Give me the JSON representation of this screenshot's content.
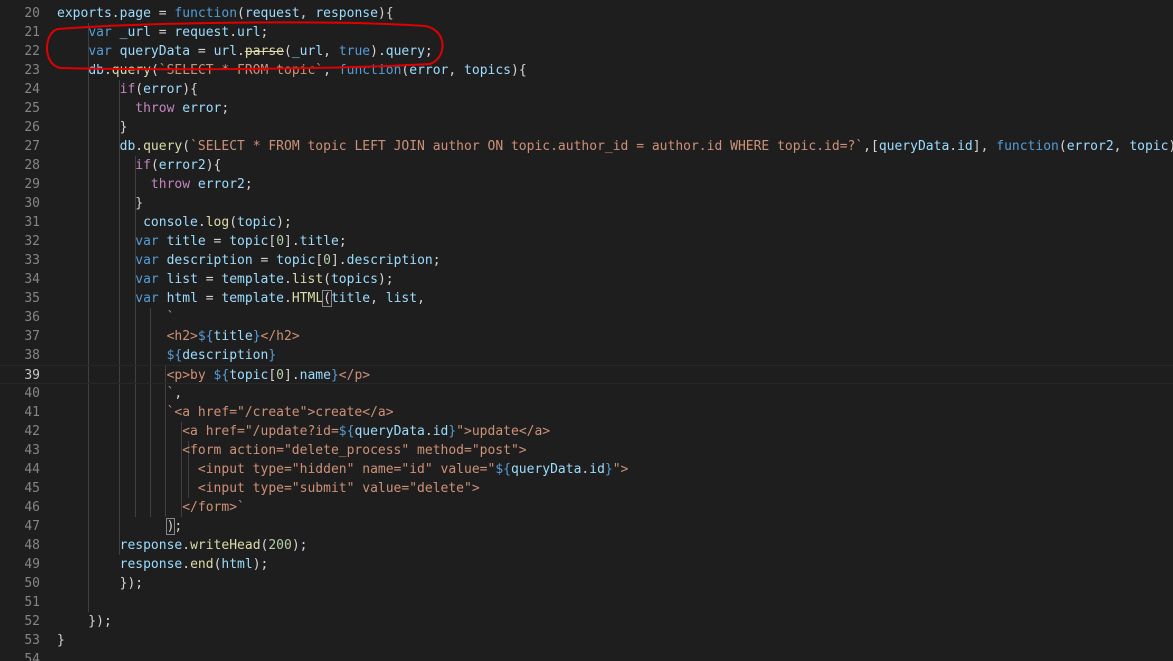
{
  "editor": {
    "colors": {
      "background": "#1e1e1e",
      "line_number": "#858585",
      "keyword": "#569cd6",
      "control": "#c586c0",
      "variable": "#9cdcfe",
      "function": "#dcdcaa",
      "string": "#ce9178",
      "number": "#b5cea8",
      "annotation": "#e00000"
    },
    "current_line": 39,
    "lines": [
      {
        "n": "20",
        "tokens": [
          [
            "var",
            "exports"
          ],
          [
            "punc",
            "."
          ],
          [
            "var",
            "page"
          ],
          [
            "punc",
            " = "
          ],
          [
            "kw",
            "function"
          ],
          [
            "punc",
            "("
          ],
          [
            "var",
            "request"
          ],
          [
            "punc",
            ", "
          ],
          [
            "var",
            "response"
          ],
          [
            "punc",
            "){"
          ]
        ]
      },
      {
        "n": "21",
        "tokens": [
          [
            "punc",
            "    "
          ],
          [
            "kw",
            "var"
          ],
          [
            "punc",
            " "
          ],
          [
            "var",
            "_url"
          ],
          [
            "punc",
            " = "
          ],
          [
            "var",
            "request"
          ],
          [
            "punc",
            "."
          ],
          [
            "var",
            "url"
          ],
          [
            "punc",
            ";"
          ]
        ]
      },
      {
        "n": "22",
        "tokens": [
          [
            "punc",
            "    "
          ],
          [
            "kw",
            "var"
          ],
          [
            "punc",
            " "
          ],
          [
            "var",
            "queryData"
          ],
          [
            "punc",
            " = "
          ],
          [
            "var",
            "url"
          ],
          [
            "punc",
            "."
          ],
          [
            "strike",
            "parse"
          ],
          [
            "punc",
            "("
          ],
          [
            "var",
            "_url"
          ],
          [
            "punc",
            ", "
          ],
          [
            "kw",
            "true"
          ],
          [
            "punc",
            ")."
          ],
          [
            "var",
            "query"
          ],
          [
            "punc",
            ";"
          ]
        ]
      },
      {
        "n": "23",
        "tokens": [
          [
            "punc",
            "    "
          ],
          [
            "var",
            "db"
          ],
          [
            "punc",
            "."
          ],
          [
            "fn",
            "query"
          ],
          [
            "punc",
            "("
          ],
          [
            "str",
            "`SELECT * FROM topic`"
          ],
          [
            "punc",
            ", "
          ],
          [
            "kw",
            "function"
          ],
          [
            "punc",
            "("
          ],
          [
            "var",
            "error"
          ],
          [
            "punc",
            ", "
          ],
          [
            "var",
            "topics"
          ],
          [
            "punc",
            "){"
          ]
        ]
      },
      {
        "n": "24",
        "tokens": [
          [
            "punc",
            "        "
          ],
          [
            "ctrl",
            "if"
          ],
          [
            "punc",
            "("
          ],
          [
            "var",
            "error"
          ],
          [
            "punc",
            "){"
          ]
        ]
      },
      {
        "n": "25",
        "tokens": [
          [
            "punc",
            "          "
          ],
          [
            "ctrl",
            "throw"
          ],
          [
            "punc",
            " "
          ],
          [
            "var",
            "error"
          ],
          [
            "punc",
            ";"
          ]
        ]
      },
      {
        "n": "26",
        "tokens": [
          [
            "punc",
            "        }"
          ]
        ]
      },
      {
        "n": "27",
        "tokens": [
          [
            "punc",
            "        "
          ],
          [
            "var",
            "db"
          ],
          [
            "punc",
            "."
          ],
          [
            "fn",
            "query"
          ],
          [
            "punc",
            "("
          ],
          [
            "str",
            "`SELECT * FROM topic LEFT JOIN author ON topic.author_id = author.id WHERE topic.id=?`"
          ],
          [
            "punc",
            ",["
          ],
          [
            "var",
            "queryData"
          ],
          [
            "punc",
            "."
          ],
          [
            "var",
            "id"
          ],
          [
            "punc",
            "], "
          ],
          [
            "kw",
            "function"
          ],
          [
            "punc",
            "("
          ],
          [
            "var",
            "error2"
          ],
          [
            "punc",
            ", "
          ],
          [
            "var",
            "topic"
          ],
          [
            "punc",
            "){"
          ]
        ]
      },
      {
        "n": "28",
        "tokens": [
          [
            "punc",
            "          "
          ],
          [
            "ctrl",
            "if"
          ],
          [
            "punc",
            "("
          ],
          [
            "var",
            "error2"
          ],
          [
            "punc",
            "){"
          ]
        ]
      },
      {
        "n": "29",
        "tokens": [
          [
            "punc",
            "            "
          ],
          [
            "ctrl",
            "throw"
          ],
          [
            "punc",
            " "
          ],
          [
            "var",
            "error2"
          ],
          [
            "punc",
            ";"
          ]
        ]
      },
      {
        "n": "30",
        "tokens": [
          [
            "punc",
            "          }"
          ]
        ]
      },
      {
        "n": "31",
        "tokens": [
          [
            "punc",
            "           "
          ],
          [
            "var",
            "console"
          ],
          [
            "punc",
            "."
          ],
          [
            "fn",
            "log"
          ],
          [
            "punc",
            "("
          ],
          [
            "var",
            "topic"
          ],
          [
            "punc",
            ");"
          ]
        ]
      },
      {
        "n": "32",
        "tokens": [
          [
            "punc",
            "          "
          ],
          [
            "kw",
            "var"
          ],
          [
            "punc",
            " "
          ],
          [
            "var",
            "title"
          ],
          [
            "punc",
            " = "
          ],
          [
            "var",
            "topic"
          ],
          [
            "punc",
            "["
          ],
          [
            "num",
            "0"
          ],
          [
            "punc",
            "]."
          ],
          [
            "var",
            "title"
          ],
          [
            "punc",
            ";"
          ]
        ]
      },
      {
        "n": "33",
        "tokens": [
          [
            "punc",
            "          "
          ],
          [
            "kw",
            "var"
          ],
          [
            "punc",
            " "
          ],
          [
            "var",
            "description"
          ],
          [
            "punc",
            " = "
          ],
          [
            "var",
            "topic"
          ],
          [
            "punc",
            "["
          ],
          [
            "num",
            "0"
          ],
          [
            "punc",
            "]."
          ],
          [
            "var",
            "description"
          ],
          [
            "punc",
            ";"
          ]
        ]
      },
      {
        "n": "34",
        "tokens": [
          [
            "punc",
            "          "
          ],
          [
            "kw",
            "var"
          ],
          [
            "punc",
            " "
          ],
          [
            "var",
            "list"
          ],
          [
            "punc",
            " = "
          ],
          [
            "var",
            "template"
          ],
          [
            "punc",
            "."
          ],
          [
            "fn",
            "list"
          ],
          [
            "punc",
            "("
          ],
          [
            "var",
            "topics"
          ],
          [
            "punc",
            ");"
          ]
        ]
      },
      {
        "n": "35",
        "tokens": [
          [
            "punc",
            "          "
          ],
          [
            "kw",
            "var"
          ],
          [
            "punc",
            " "
          ],
          [
            "var",
            "html"
          ],
          [
            "punc",
            " = "
          ],
          [
            "var",
            "template"
          ],
          [
            "punc",
            "."
          ],
          [
            "fn",
            "HTML"
          ],
          [
            "bracket",
            "("
          ],
          [
            "var",
            "title"
          ],
          [
            "punc",
            ", "
          ],
          [
            "var",
            "list"
          ],
          [
            "punc",
            ","
          ]
        ]
      },
      {
        "n": "36",
        "tokens": [
          [
            "punc",
            "              "
          ],
          [
            "str",
            "`"
          ]
        ]
      },
      {
        "n": "37",
        "tokens": [
          [
            "punc",
            "              "
          ],
          [
            "str",
            "<h2>"
          ],
          [
            "tmpl",
            "${"
          ],
          [
            "var",
            "title"
          ],
          [
            "tmpl",
            "}"
          ],
          [
            "str",
            "</h2>"
          ]
        ]
      },
      {
        "n": "38",
        "tokens": [
          [
            "punc",
            "              "
          ],
          [
            "tmpl",
            "${"
          ],
          [
            "var",
            "description"
          ],
          [
            "tmpl",
            "}"
          ]
        ]
      },
      {
        "n": "39",
        "tokens": [
          [
            "punc",
            "              "
          ],
          [
            "str",
            "<p>by "
          ],
          [
            "tmpl",
            "${"
          ],
          [
            "var",
            "topic"
          ],
          [
            "punc",
            "["
          ],
          [
            "num",
            "0"
          ],
          [
            "punc",
            "]."
          ],
          [
            "var",
            "name"
          ],
          [
            "tmpl",
            "}"
          ],
          [
            "str",
            "</p>"
          ]
        ]
      },
      {
        "n": "40",
        "tokens": [
          [
            "punc",
            "              "
          ],
          [
            "str",
            "`"
          ],
          [
            "punc",
            ","
          ]
        ]
      },
      {
        "n": "41",
        "tokens": [
          [
            "punc",
            "              "
          ],
          [
            "str",
            "`<a href=\"/create\">create</a>"
          ]
        ]
      },
      {
        "n": "42",
        "tokens": [
          [
            "punc",
            "                "
          ],
          [
            "str",
            "<a href=\"/update?id="
          ],
          [
            "tmpl",
            "${"
          ],
          [
            "var",
            "queryData"
          ],
          [
            "punc",
            "."
          ],
          [
            "var",
            "id"
          ],
          [
            "tmpl",
            "}"
          ],
          [
            "str",
            "\">update</a>"
          ]
        ]
      },
      {
        "n": "43",
        "tokens": [
          [
            "punc",
            "                "
          ],
          [
            "str",
            "<form action=\"delete_process\" method=\"post\">"
          ]
        ]
      },
      {
        "n": "44",
        "tokens": [
          [
            "punc",
            "                  "
          ],
          [
            "str",
            "<input type=\"hidden\" name=\"id\" value=\""
          ],
          [
            "tmpl",
            "${"
          ],
          [
            "var",
            "queryData"
          ],
          [
            "punc",
            "."
          ],
          [
            "var",
            "id"
          ],
          [
            "tmpl",
            "}"
          ],
          [
            "str",
            "\">"
          ]
        ]
      },
      {
        "n": "45",
        "tokens": [
          [
            "punc",
            "                  "
          ],
          [
            "str",
            "<input type=\"submit\" value=\"delete\">"
          ]
        ]
      },
      {
        "n": "46",
        "tokens": [
          [
            "punc",
            "                "
          ],
          [
            "str",
            "</form>`"
          ]
        ]
      },
      {
        "n": "47",
        "tokens": [
          [
            "punc",
            "              "
          ],
          [
            "bracket",
            ")"
          ],
          [
            "punc",
            ";"
          ]
        ]
      },
      {
        "n": "48",
        "tokens": [
          [
            "punc",
            "        "
          ],
          [
            "var",
            "response"
          ],
          [
            "punc",
            "."
          ],
          [
            "fn",
            "writeHead"
          ],
          [
            "punc",
            "("
          ],
          [
            "num",
            "200"
          ],
          [
            "punc",
            ");"
          ]
        ]
      },
      {
        "n": "49",
        "tokens": [
          [
            "punc",
            "        "
          ],
          [
            "var",
            "response"
          ],
          [
            "punc",
            "."
          ],
          [
            "fn",
            "end"
          ],
          [
            "punc",
            "("
          ],
          [
            "var",
            "html"
          ],
          [
            "punc",
            ");"
          ]
        ]
      },
      {
        "n": "50",
        "tokens": [
          [
            "punc",
            "        });"
          ]
        ]
      },
      {
        "n": "51",
        "tokens": []
      },
      {
        "n": "52",
        "tokens": [
          [
            "punc",
            "    });"
          ]
        ]
      },
      {
        "n": "53",
        "tokens": [
          [
            "punc",
            "}"
          ]
        ]
      },
      {
        "n": "54",
        "tokens": []
      }
    ]
  }
}
